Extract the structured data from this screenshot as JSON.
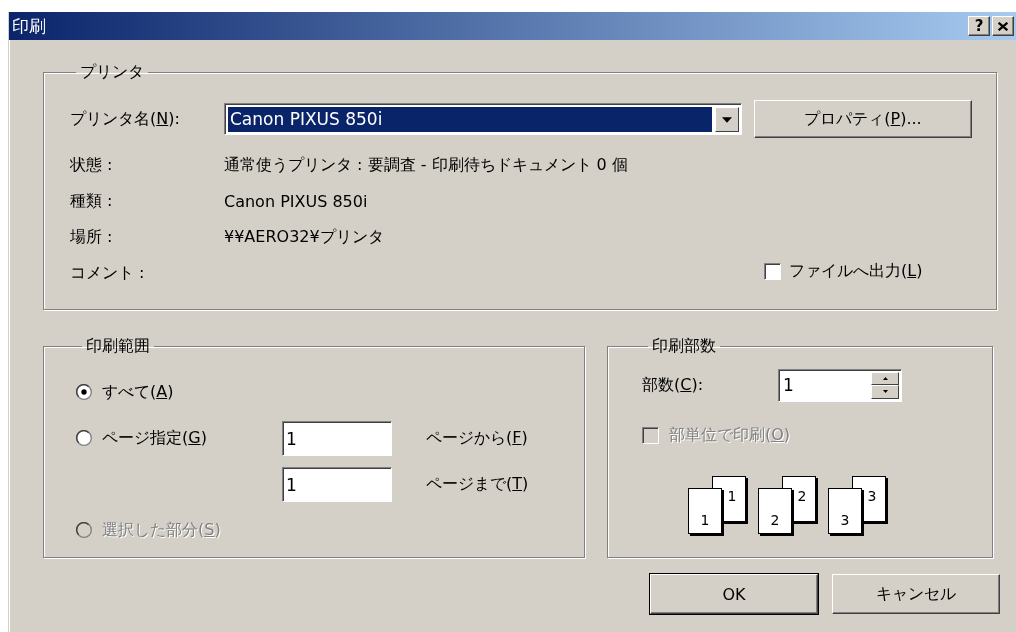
{
  "window": {
    "title": "印刷",
    "title_buttons": [
      {
        "kind": "help",
        "label": "?"
      },
      {
        "kind": "close"
      }
    ]
  },
  "printer": {
    "legend": "プリンタ",
    "name_label": {
      "text": "プリンタ名(",
      "access_key": "N",
      "text_end": "):"
    },
    "name_value": "Canon PIXUS 850i",
    "properties_button": {
      "text": "プロパティ(",
      "access_key": "P",
      "text_end": ")..."
    },
    "info": [
      {
        "label": "状態 :",
        "value": "通常使うプリンタ : 要調査 - 印刷待ちドキュメント 0 個"
      },
      {
        "label": "種類 :",
        "value": "Canon PIXUS 850i"
      },
      {
        "label": "場所 :",
        "value": "¥¥AERO32¥プリンタ"
      },
      {
        "label": "コメント :"
      }
    ],
    "print_to_file": {
      "text": "ファイルへ出力(",
      "access_key": "L",
      "text_end": ")",
      "checked": false
    }
  },
  "range": {
    "legend": "印刷範囲",
    "options": [
      {
        "text": "すべて(",
        "access_key": "A",
        "text_end": ")",
        "selected": true,
        "disabled": false
      },
      {
        "text": "ページ指定(",
        "access_key": "G",
        "text_end": ")",
        "selected": false,
        "disabled": false
      },
      {
        "text": "選択した部分(",
        "access_key": "S",
        "text_end": ")",
        "selected": false,
        "disabled": true
      }
    ],
    "from": {
      "value": "1",
      "text": "ページから(",
      "access_key": "F",
      "text_end": ")"
    },
    "to": {
      "value": "1",
      "text": "ページまで(",
      "access_key": "T",
      "text_end": ")"
    }
  },
  "copies": {
    "legend": "印刷部数",
    "count_label": {
      "text": "部数(",
      "access_key": "C",
      "text_end": "):"
    },
    "count_value": "1",
    "collate": {
      "text": "部単位で印刷(",
      "access_key": "O",
      "text_end": ")",
      "checked": false,
      "disabled": true
    },
    "collate_sets": [
      {
        "front": "1",
        "back": "1"
      },
      {
        "front": "2",
        "back": "2"
      },
      {
        "front": "3",
        "back": "3"
      }
    ]
  },
  "buttons": [
    {
      "text": "OK",
      "default": true
    },
    {
      "text": "キャンセル",
      "default": false
    }
  ]
}
